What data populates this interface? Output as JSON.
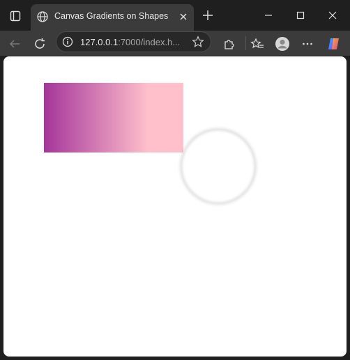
{
  "browser": {
    "tab": {
      "title": "Canvas Gradients on Shapes"
    },
    "address": {
      "host": "127.0.0.1",
      "rest": ":7000/index.h..."
    },
    "icons": {
      "tab_actions": "tab-actions-icon",
      "globe": "globe-icon",
      "close_tab": "close-icon",
      "new_tab": "plus-icon",
      "minimize": "minimize-icon",
      "maximize": "maximize-icon",
      "close_window": "close-icon",
      "back": "back-arrow-icon",
      "refresh": "refresh-icon",
      "info": "info-icon",
      "favorite": "star-icon",
      "extensions": "puzzle-icon",
      "favorites": "favorites-icon",
      "profile": "profile-icon",
      "more": "more-icon",
      "copilot": "copilot-icon"
    }
  },
  "page": {
    "gradient_rect": {
      "colors": [
        "#a6359b",
        "#ffc0cb"
      ],
      "stop_mid": "#ffc0cb"
    },
    "circle": {
      "fill": "#ffffff"
    }
  },
  "colors": {
    "titlebar": "#1f1f1f",
    "toolbar": "#3b3b3b",
    "viewport": "#ffffff"
  }
}
